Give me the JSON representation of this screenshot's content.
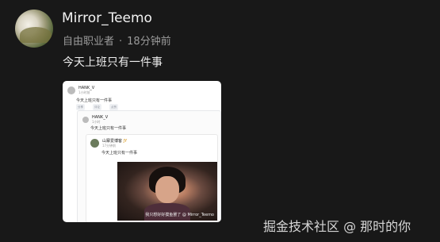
{
  "post": {
    "username": "Mirror_Teemo",
    "role": "自由职业者",
    "separator": "·",
    "time": "18分钟前",
    "text": "今天上班只有一件事"
  },
  "screenshot": {
    "top_author": "HANK_V",
    "top_sub": "1小时前",
    "top_text": "今天上班只有一件事",
    "pills": [
      "分享",
      "评论",
      "点赞"
    ],
    "mid_author": "HANK_V",
    "mid_sub": "1小时",
    "mid_text": "今天上班只有一件事",
    "inner_author": "山寨爱博客",
    "inner_badge": "JY",
    "inner_sub": "17分钟前",
    "inner_text": "今天上班只有一件事",
    "subtitle": "我只想好好摸鱼罢了 @ Mirror_Teemo"
  },
  "watermark": "掘金技术社区 @ 那时的你"
}
